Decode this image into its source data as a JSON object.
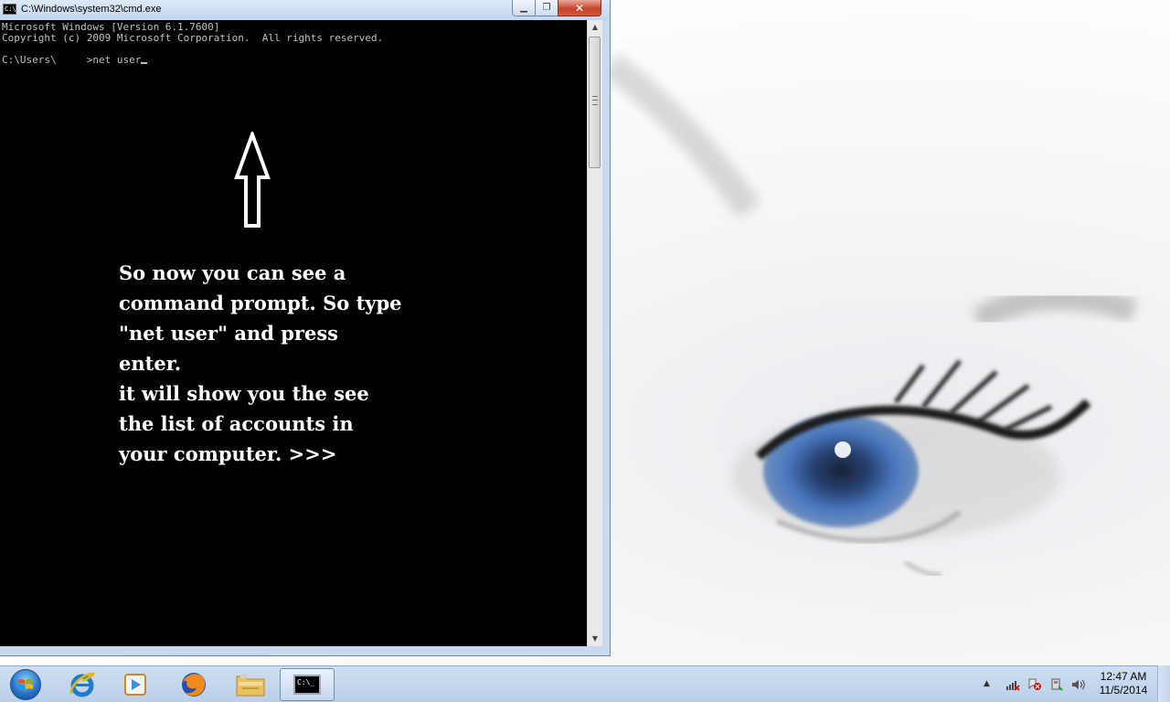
{
  "window": {
    "title": "C:\\Windows\\system32\\cmd.exe",
    "icon_label": "C:\\",
    "minimize_glyph": "▁",
    "maximize_glyph": "❐",
    "close_glyph": "✕"
  },
  "console": {
    "lines": [
      "Microsoft Windows [Version 6.1.7600]",
      "Copyright (c) 2009 Microsoft Corporation.  All rights reserved.",
      "",
      "C:\\Users\\     >net user"
    ]
  },
  "annotation": {
    "lines": [
      "So now you can see a",
      "command prompt. So type",
      "\"net user\" and press",
      "enter.",
      "it will show you the see",
      "the list of accounts in",
      "your computer. >>>"
    ]
  },
  "taskbar": {
    "items": [
      "start-button",
      "internet-explorer-icon",
      "media-player-icon",
      "firefox-icon",
      "file-explorer-icon",
      "cmd-icon"
    ],
    "cmd_label": "C:\\_"
  },
  "tray": {
    "expand_glyph": "▲",
    "time": "12:47 AM",
    "date": "11/5/2014"
  },
  "colors": {
    "console_bg": "#000000",
    "console_text": "#c0c0c0",
    "annotation_text": "#ffffff",
    "iris": "#3a64a8"
  }
}
